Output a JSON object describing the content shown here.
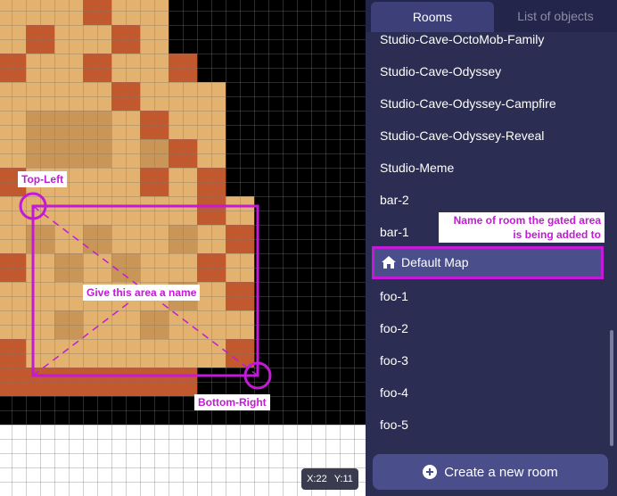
{
  "colors": {
    "sand": "#e2b26e",
    "sand_dark": "#c99658",
    "terracotta": "#c2582e",
    "black": "#000000",
    "annotation": "#c21ad6",
    "panel_bg": "#2b2d52",
    "tab_bar_bg": "#23254a",
    "selected_bg": "#4a4e8a"
  },
  "map": {
    "coords": {
      "x": "X:22",
      "y": "Y:11"
    },
    "annotations": {
      "top_left": "Top-Left",
      "bottom_right": "Bottom-Right",
      "area_name_hint": "Give this area a name"
    }
  },
  "sidebar": {
    "tabs": [
      {
        "label": "Rooms",
        "active": true
      },
      {
        "label": "List of objects",
        "active": false
      }
    ],
    "rooms": [
      "Studio-Cave-OctoMob-Family",
      "Studio-Cave-Odyssey",
      "Studio-Cave-Odyssey-Campfire",
      "Studio-Cave-Odyssey-Reveal",
      "Studio-Meme",
      "bar-2",
      "bar-1",
      "Default Map",
      "foo-1",
      "foo-2",
      "foo-3",
      "foo-4",
      "foo-5"
    ],
    "selected_room": "Default Map",
    "selected_icon": "home-icon",
    "room_annotation": "Name of room the gated area is being added to",
    "create_button": "Create a new room",
    "create_icon": "plus-circle-icon"
  }
}
